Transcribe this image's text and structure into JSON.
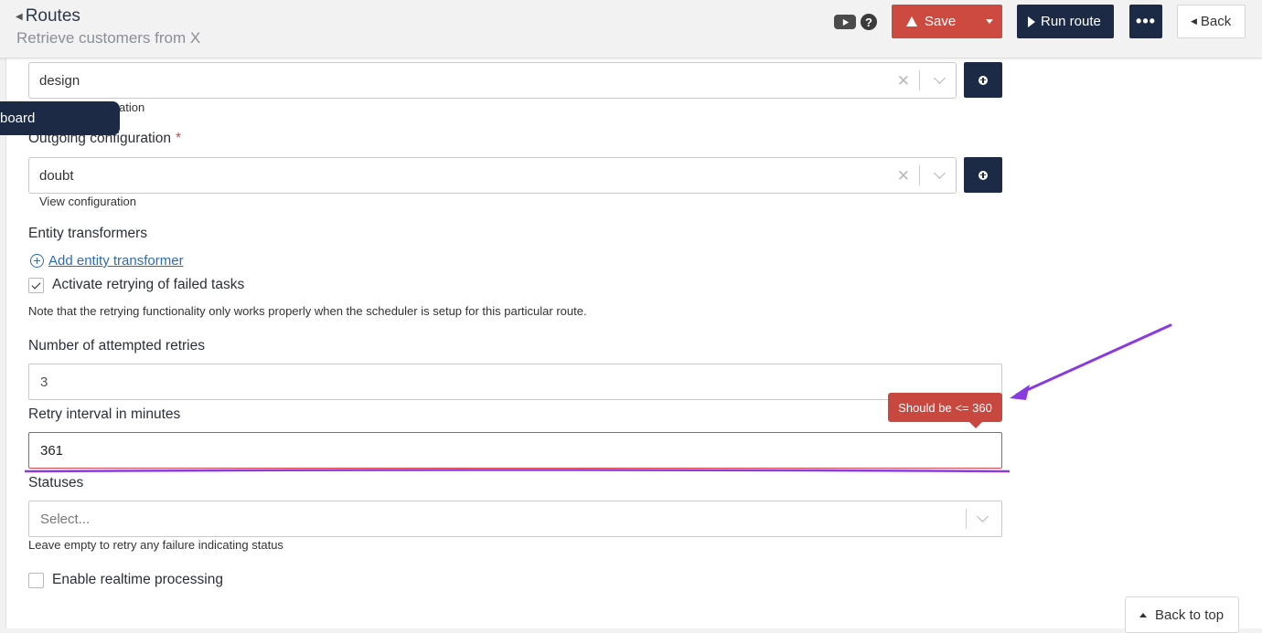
{
  "header": {
    "breadcrumb": "Routes",
    "subtitle": "Retrieve customers from X",
    "video_icon": "youtube-icon",
    "help_icon": "help-icon",
    "save_label": "Save",
    "run_label": "Run route",
    "more_label": "•••",
    "back_label": "Back"
  },
  "sidebar": {
    "pill_label": "board"
  },
  "form": {
    "incoming": {
      "value": "design",
      "link": "ation"
    },
    "outgoing": {
      "label": "Outgoing configuration",
      "required": "*",
      "value": "doubt",
      "link": "View configuration"
    },
    "entity": {
      "label": "Entity transformers",
      "add_link": "Add entity transformer"
    },
    "retry": {
      "checkbox_label": "Activate retrying of failed tasks",
      "checked": true,
      "note": "Note that the retrying functionality only works properly when the scheduler is setup for this particular route."
    },
    "attempts": {
      "label": "Number of attempted retries",
      "value": "3"
    },
    "interval": {
      "label": "Retry interval in minutes",
      "value": "361",
      "error": "Should be <= 360"
    },
    "statuses": {
      "label": "Statuses",
      "placeholder": "Select...",
      "help": "Leave empty to retry any failure indicating status"
    },
    "realtime": {
      "checkbox_label": "Enable realtime processing",
      "checked": false
    }
  },
  "back_to_top": "Back to top",
  "colors": {
    "primary": "#1c2a46",
    "danger": "#cc4a3f",
    "link": "#2d6bb8",
    "annotation": "#8a3be0"
  }
}
